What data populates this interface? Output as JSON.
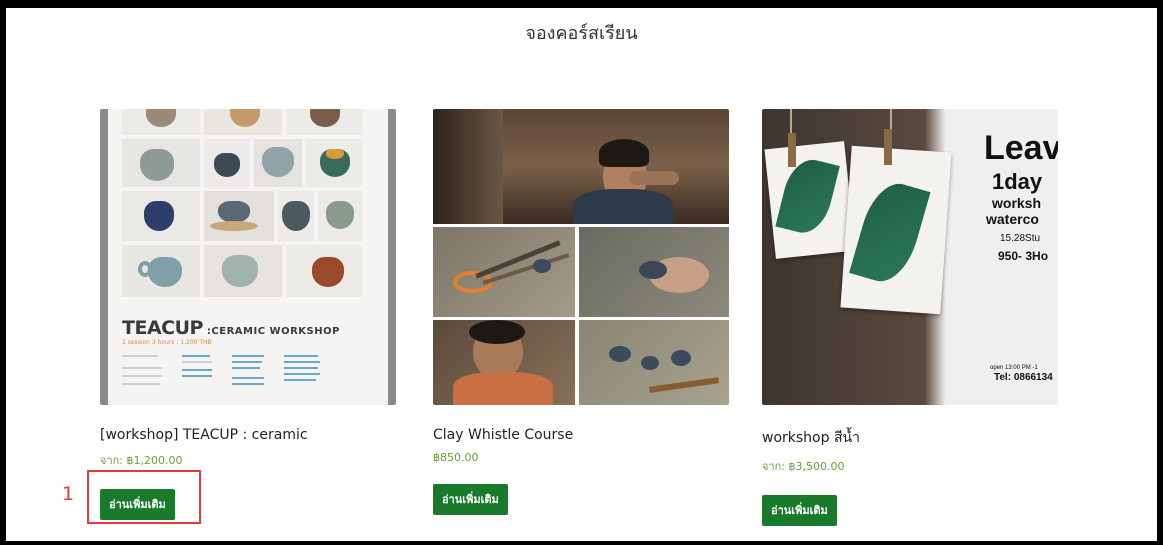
{
  "page": {
    "title": "จองคอร์สเรียน"
  },
  "products": [
    {
      "name": "[workshop] TEACUP : ceramic",
      "price": "จาก: ฿1,200.00",
      "button": "อ่านเพิ่มเติม",
      "poster": {
        "title_main": "TEACUP",
        "title_rest": " :CERAMIC WORKSHOP",
        "subtitle": "1 session 3 hours : 1,200 THB"
      }
    },
    {
      "name": "Clay Whistle Course",
      "price": "฿850.00",
      "button": "อ่านเพิ่มเติม"
    },
    {
      "name": "workshop สีน้ำ",
      "price": "จาก: ฿3,500.00",
      "button": "อ่านเพิ่มเติม",
      "poster": {
        "line1": "Leav",
        "line2": "1day",
        "line3": "worksh",
        "line4": "waterco",
        "line5": "15.28Stu",
        "line6": "950- 3Ho",
        "line7": "open 13:00 PM -1",
        "line8": "Tel: 0866134"
      }
    }
  ],
  "annotation": {
    "label": "1",
    "color": "#e53935"
  },
  "colors": {
    "button_bg": "#1a7a2c",
    "price": "#6a9d3b"
  }
}
